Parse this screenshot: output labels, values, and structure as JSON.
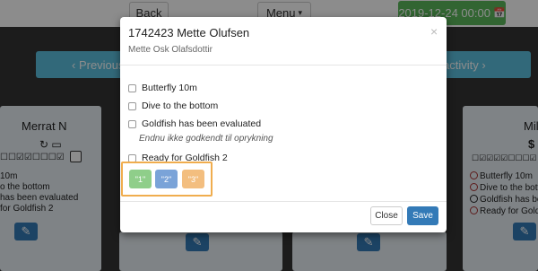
{
  "topbar": {
    "back_label": "Back",
    "menu_label": "Menu",
    "menu_caret": "▾",
    "date_label": "2019-12-24 00:00",
    "date_icon": "📅"
  },
  "nav": {
    "prev_label": "‹ Previous",
    "next_label": "activity ›"
  },
  "cards": {
    "left": {
      "name": "Merrat N",
      "checks": "☐☐☑☑☐☐☐☑",
      "lines": [
        "10m",
        "o the bottom",
        "has been evaluated",
        "for Goldfish 2"
      ]
    },
    "right": {
      "name": "Mil",
      "symbol": "$",
      "checks": "☐☑☑☑☑☐☐☐☑",
      "lines": [
        "Butterfly 10m",
        "Dive to the bottom",
        "Goldfish has been ev",
        "Ready for Goldfish 2"
      ]
    }
  },
  "modal": {
    "title": "1742423 Mette Olufsen",
    "subtitle": "Mette Osk Olafsdottir",
    "close_glyph": "×",
    "tasks": [
      {
        "label": "Butterfly 10m"
      },
      {
        "label": "Dive to the bottom"
      },
      {
        "label": "Goldfish has been evaluated"
      },
      {
        "label": "Ready for Goldfish 2"
      }
    ],
    "task_note": "Endnu ikke godkendt til oprykning",
    "grades": [
      {
        "label": "\"1\"",
        "color": "#8fce8a"
      },
      {
        "label": "\"2\"",
        "color": "#7aa3d8"
      },
      {
        "label": "\"3\"",
        "color": "#f3be7f"
      }
    ],
    "close_button": "Close",
    "save_button": "Save"
  },
  "colors": {
    "accent_blue": "#337ab7",
    "info_blue": "#5bc0de",
    "success_green": "#5cb85c",
    "highlight_orange": "#f0ad4e"
  }
}
